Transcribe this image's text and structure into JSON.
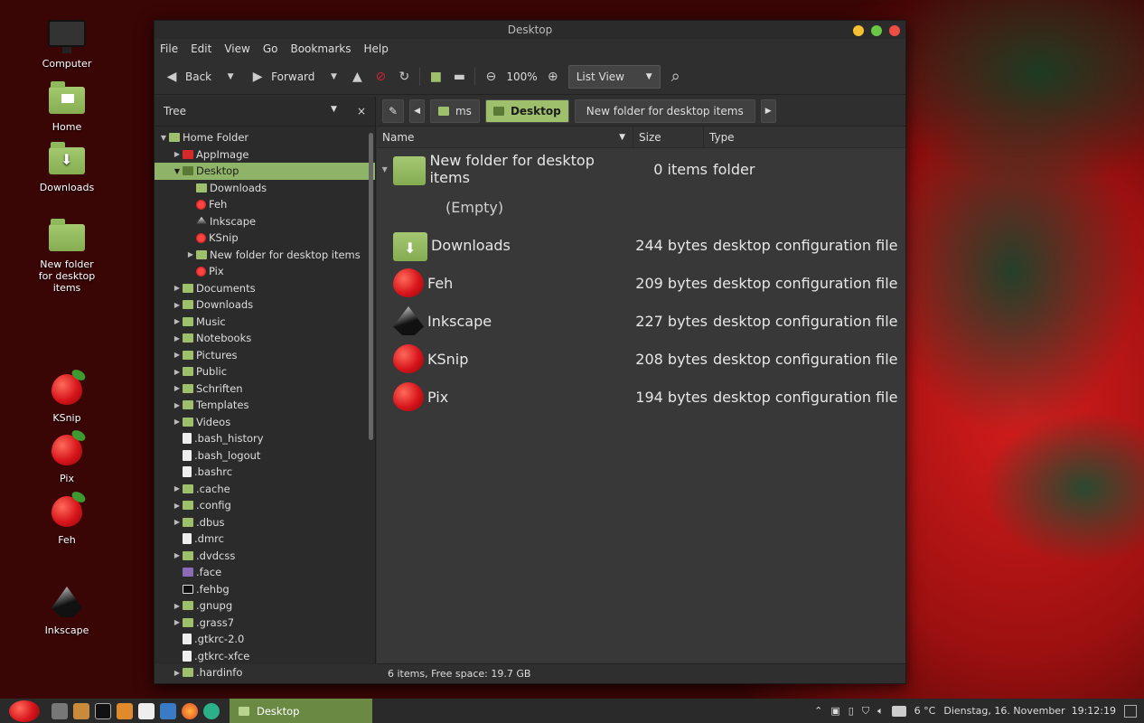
{
  "desktop": {
    "icons": [
      {
        "label": "Computer"
      },
      {
        "label": "Home"
      },
      {
        "label": "Downloads"
      },
      {
        "label": "New folder for desktop items"
      },
      {
        "label": "KSnip"
      },
      {
        "label": "Pix"
      },
      {
        "label": "Feh"
      },
      {
        "label": "Inkscape"
      }
    ]
  },
  "window": {
    "title": "Desktop",
    "menu": [
      "File",
      "Edit",
      "View",
      "Go",
      "Bookmarks",
      "Help"
    ],
    "toolbar": {
      "back": "Back",
      "forward": "Forward",
      "zoom": "100%",
      "view_mode": "List View"
    },
    "sidebar": {
      "header": "Tree",
      "items": [
        {
          "label": "Home Folder"
        },
        {
          "label": "AppImage"
        },
        {
          "label": "Desktop"
        },
        {
          "label": "Downloads"
        },
        {
          "label": "Feh"
        },
        {
          "label": "Inkscape"
        },
        {
          "label": "KSnip"
        },
        {
          "label": "New folder for desktop items"
        },
        {
          "label": "Pix"
        },
        {
          "label": "Documents"
        },
        {
          "label": "Downloads"
        },
        {
          "label": "Music"
        },
        {
          "label": "Notebooks"
        },
        {
          "label": "Pictures"
        },
        {
          "label": "Public"
        },
        {
          "label": "Schriften"
        },
        {
          "label": "Templates"
        },
        {
          "label": "Videos"
        },
        {
          "label": ".bash_history"
        },
        {
          "label": ".bash_logout"
        },
        {
          "label": ".bashrc"
        },
        {
          "label": ".cache"
        },
        {
          "label": ".config"
        },
        {
          "label": ".dbus"
        },
        {
          "label": ".dmrc"
        },
        {
          "label": ".dvdcss"
        },
        {
          "label": ".face"
        },
        {
          "label": ".fehbg"
        },
        {
          "label": ".gnupg"
        },
        {
          "label": ".grass7"
        },
        {
          "label": ".gtkrc-2.0"
        },
        {
          "label": ".gtkrc-xfce"
        },
        {
          "label": ".hardinfo"
        }
      ]
    },
    "pathbar": [
      "ms",
      "Desktop",
      "New folder for desktop items"
    ],
    "columns": {
      "name": "Name",
      "size": "Size",
      "type": "Type"
    },
    "files": [
      {
        "name": "New folder for desktop items",
        "size": "0 items",
        "type": "folder"
      },
      {
        "name": "(Empty)",
        "size": "",
        "type": ""
      },
      {
        "name": "Downloads",
        "size": "244 bytes",
        "type": "desktop configuration file"
      },
      {
        "name": "Feh",
        "size": "209 bytes",
        "type": "desktop configuration file"
      },
      {
        "name": "Inkscape",
        "size": "227 bytes",
        "type": "desktop configuration file"
      },
      {
        "name": "KSnip",
        "size": "208 bytes",
        "type": "desktop configuration file"
      },
      {
        "name": "Pix",
        "size": "194 bytes",
        "type": "desktop configuration file"
      }
    ],
    "status": "6 items, Free space: 19.7 GB"
  },
  "taskbar": {
    "task": "Desktop",
    "temperature": "6 °C",
    "datetime": "Dienstag, 16. November  19:12:19"
  }
}
